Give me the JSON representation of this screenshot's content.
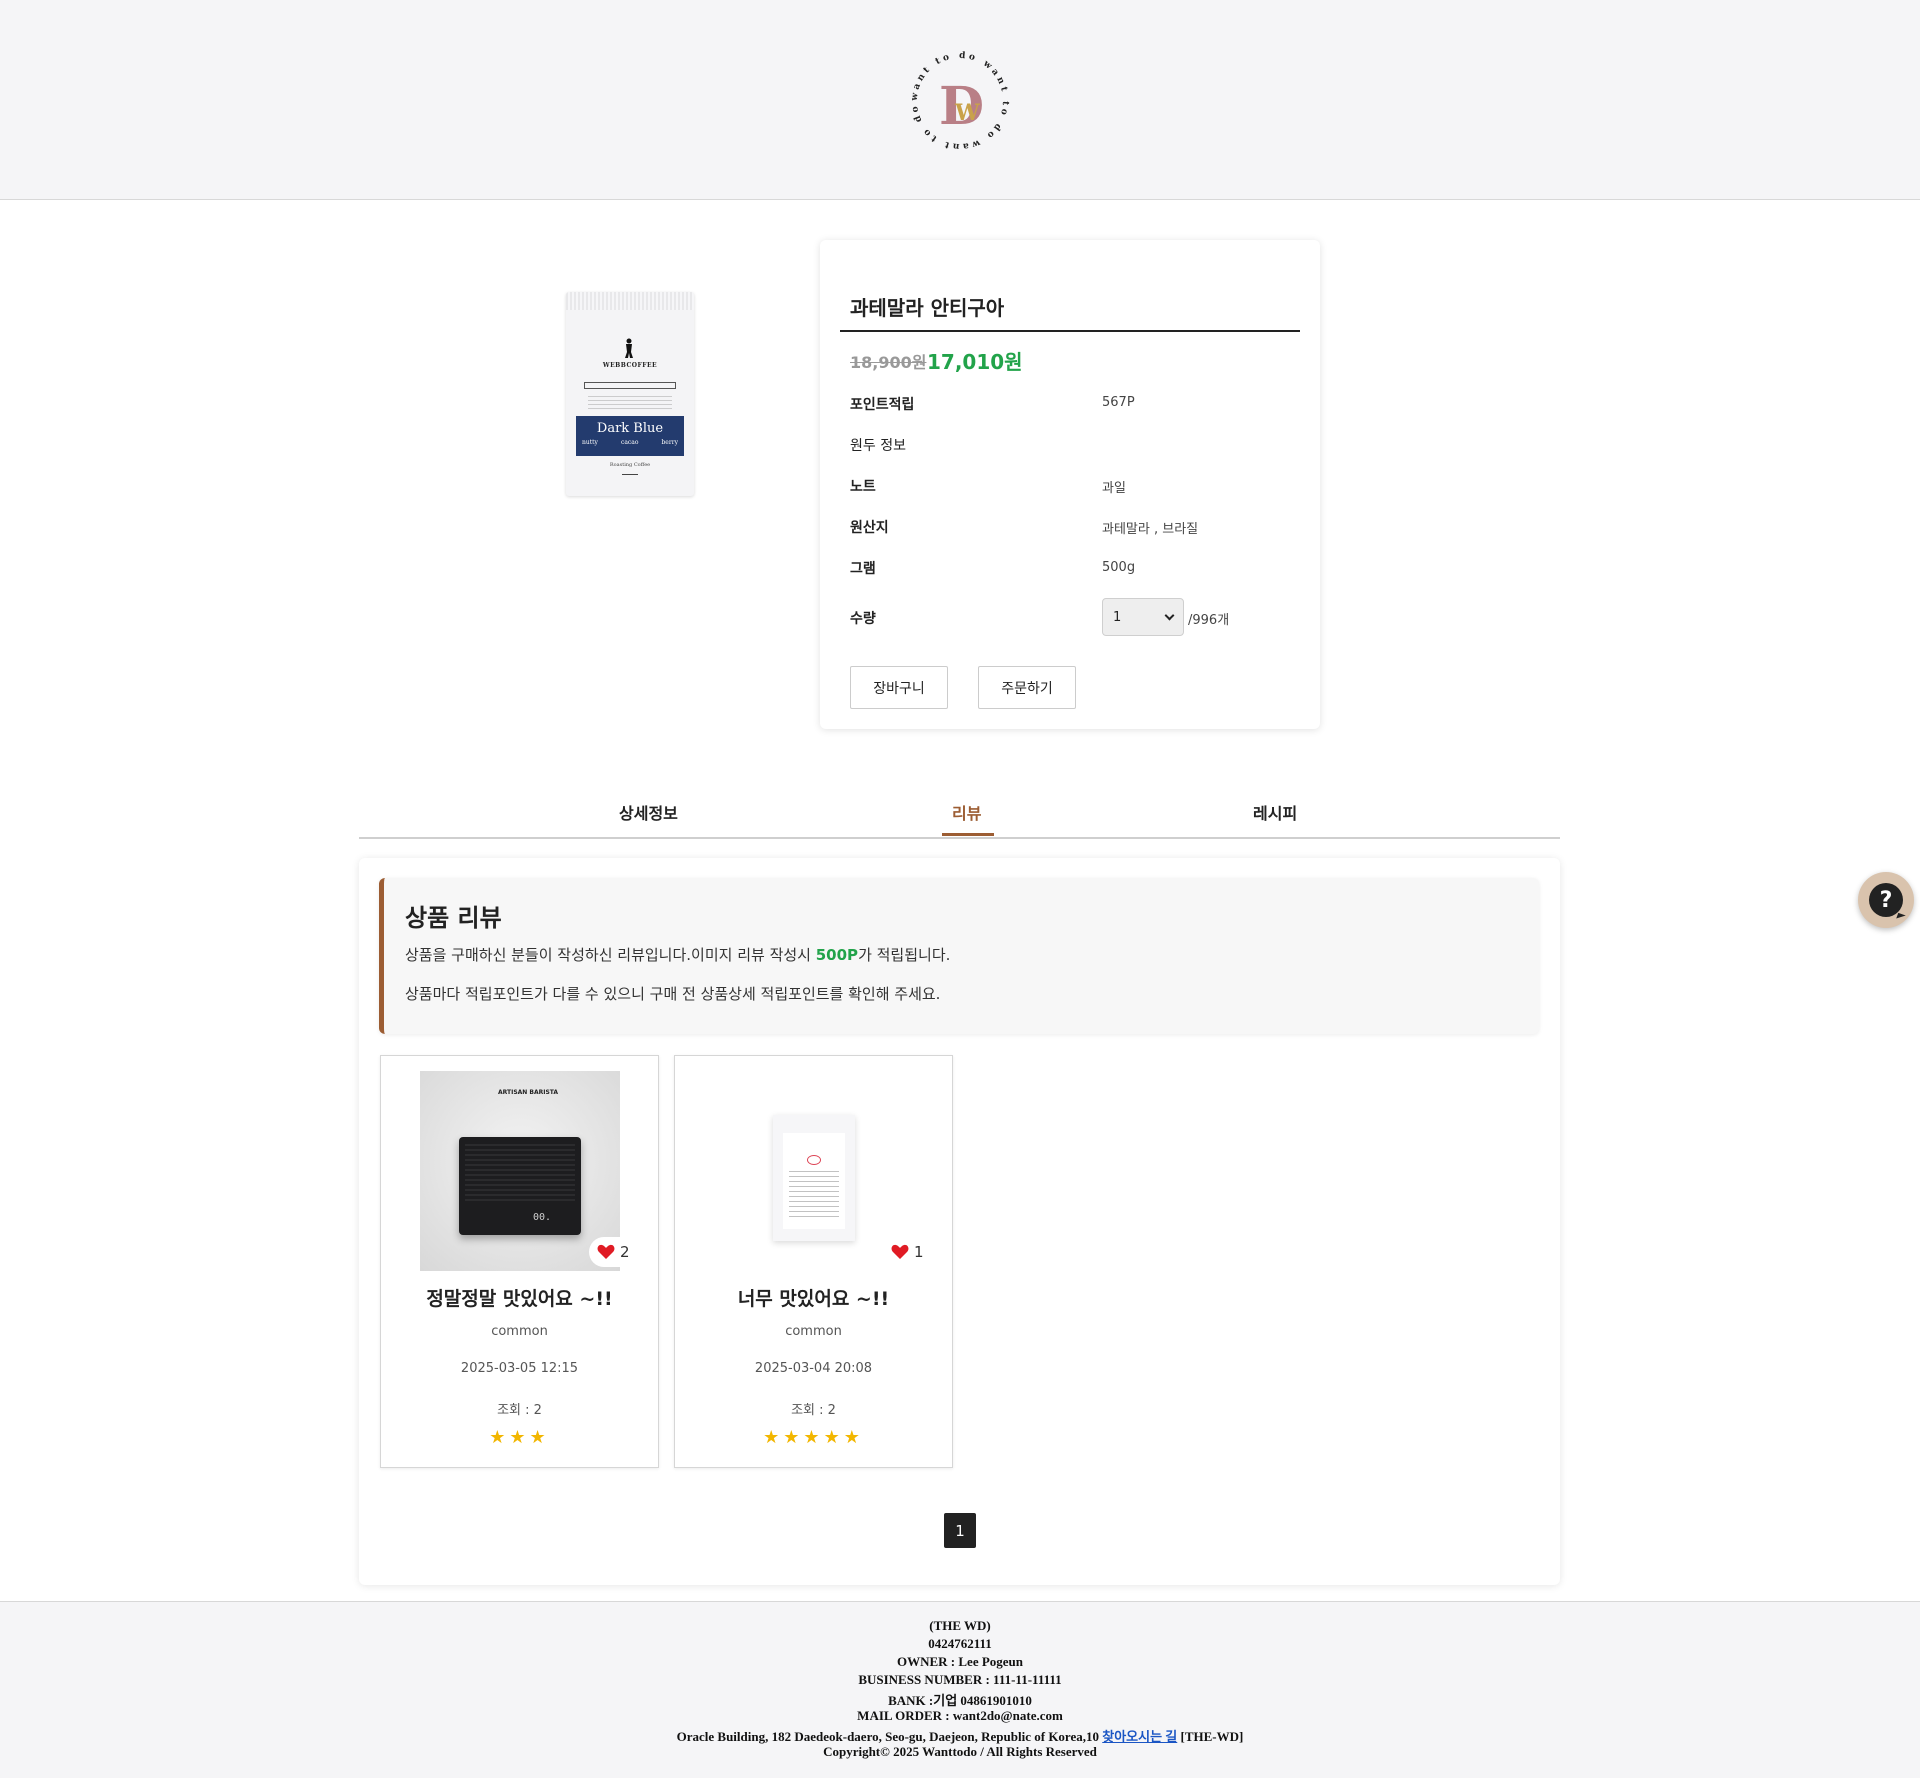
{
  "header": {
    "logo_letters": "DW",
    "logo_ring_text": "want to do want to do want to do"
  },
  "product": {
    "image": {
      "brand": "WEBBCOFFEE",
      "label_title": "Dark Blue",
      "label_notes": [
        "nutty",
        "cacao",
        "berry"
      ],
      "roast": "Roasting Coffee"
    },
    "title": "과테말라 안티구아",
    "original_price": "18,900원",
    "sale_price": "17,010원",
    "rows": [
      {
        "label": "포인트적립",
        "value": "567P"
      },
      {
        "label": "원두 정보",
        "value": ""
      },
      {
        "label": "노트",
        "value": "과일"
      },
      {
        "label": "원산지",
        "value": "과테말라 , 브라질"
      },
      {
        "label": "그램",
        "value": "500g"
      }
    ],
    "quantity_label": "수량",
    "quantity_selected": "1",
    "stock_text": "/996개",
    "cart_button": "장바구니",
    "order_button": "주문하기"
  },
  "tabs": [
    {
      "label": "상세정보",
      "active": false
    },
    {
      "label": "리뷰",
      "active": true
    },
    {
      "label": "레시피",
      "active": false
    }
  ],
  "reviews_notice": {
    "title": "상품 리뷰",
    "line1_before": "상품을 구매하신 분들이 작성하신 리뷰입니다.이미지 리뷰 작성시 ",
    "line1_points": "500P",
    "line1_after": "가 적립됩니다.",
    "line2": "상품마다 적립포인트가 다를 수 있으니 구매 전 상품상세 적립포인트를 확인해 주세요."
  },
  "reviews": [
    {
      "title": "정말정말 맛있어요 ~!!",
      "author": "common",
      "date": "2025-03-05 12:15",
      "views": "조회 : 2",
      "likes": "2",
      "rating": 3,
      "stars": "★★★",
      "image_brand": "ARTISAN BARISTA",
      "image_display": "00.",
      "image": "scale"
    },
    {
      "title": "너무 맛있어요 ~!!",
      "author": "common",
      "date": "2025-03-04 20:08",
      "views": "조회 : 2",
      "likes": "1",
      "rating": 5,
      "stars": "★★★★★",
      "image": "coffee-bag"
    }
  ],
  "pagination": {
    "current": "1"
  },
  "footer": {
    "company": "(THE WD)",
    "phone": "0424762111",
    "owner": "OWNER : Lee Pogeun",
    "business": "BUSINESS NUMBER : 111-11-11111",
    "bank": "BANK :기업 04861901010",
    "mail": "MAIL ORDER : want2do@nate.com",
    "address": "Oracle Building, 182 Daedeok-daero, Seo-gu, Daejeon, Republic of Korea,10 ",
    "directions_link": "찾아오시는 길",
    "address_suffix": " [THE-WD]",
    "copyright": "Copyright© 2025 Wanttodo / All Rights Reserved"
  },
  "colors": {
    "accent_brown": "#9c5d33",
    "price_green": "#22a34a",
    "star_yellow": "#f2b600",
    "heart_red": "#e01b24",
    "help_button": "#d9c3ad"
  },
  "icons": {
    "help": "question-chat-icon",
    "like": "heart-icon",
    "select": "chevron-down-icon"
  }
}
